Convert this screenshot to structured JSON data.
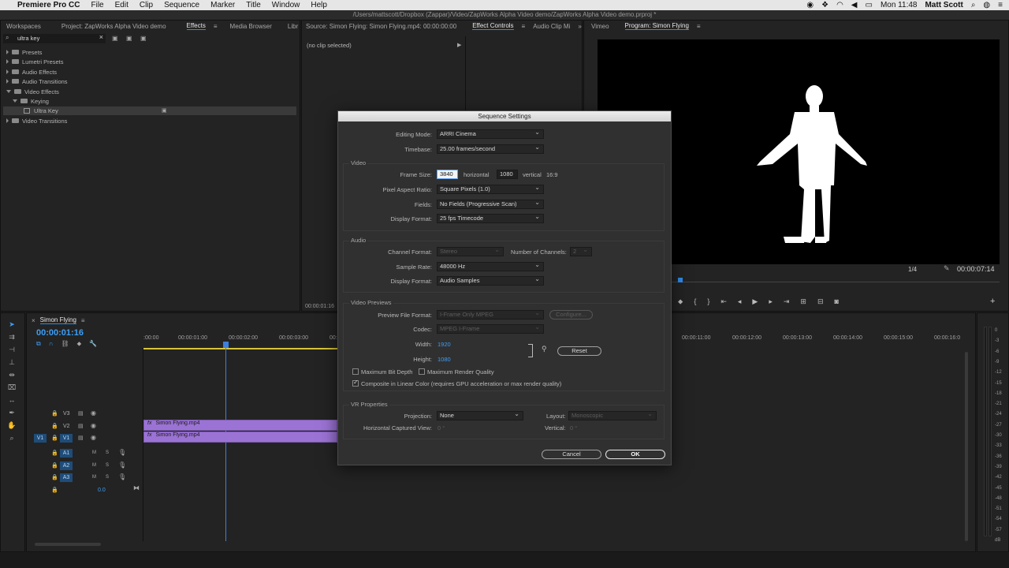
{
  "menubar": {
    "apple": "",
    "app_name": "Premiere Pro CC",
    "menus": [
      "File",
      "Edit",
      "Clip",
      "Sequence",
      "Marker",
      "Title",
      "Window",
      "Help"
    ],
    "clock": "Mon 11:48",
    "user": "Matt Scott"
  },
  "window_title": "/Users/mattscott/Dropbox (Zappar)/Video/ZapWorks Alpha Video demo/ZapWorks Alpha Video demo.prproj *",
  "left_panel": {
    "tabs": [
      "Workspaces",
      "Project: ZapWorks Alpha Video demo",
      "Effects",
      "Media Browser",
      "Libr"
    ],
    "search_value": "ultra key",
    "tree": [
      "Presets",
      "Lumetri Presets",
      "Audio Effects",
      "Audio Transitions",
      "Video Effects",
      "Keying",
      "Ultra Key",
      "Video Transitions"
    ]
  },
  "source_panel": {
    "tabs": [
      "Source: Simon Flying: Simon Flying.mp4: 00:00:00:00",
      "Effect Controls",
      "Audio Clip Mi"
    ],
    "no_clip": "(no clip selected)",
    "timecode": "00:00:01:16"
  },
  "program_panel": {
    "tabs": [
      "Vimeo",
      "Program: Simon Flying"
    ],
    "zoom": "1/4",
    "timecode": "00:00:07:14"
  },
  "timeline": {
    "tab": "Simon Flying",
    "timecode": "00:00:01:16",
    "ruler": [
      ":00:00",
      "00:00:01:00",
      "00:00:02:00",
      "00:00:03:00",
      "00:",
      "00:00:11:00",
      "00:00:12:00",
      "00:00:13:00",
      "00:00:14:00",
      "00:00:15:00",
      "00:00:16:0"
    ],
    "video_tracks": [
      "V3",
      "V2",
      "V1"
    ],
    "audio_tracks": [
      "A1",
      "A2",
      "A3"
    ],
    "source_patch": "V1",
    "mute": "M",
    "solo": "S",
    "master_level": "0.0",
    "clips": [
      "Simon Flying.mp4",
      "Simon Flying.mp4"
    ],
    "meter_db": [
      "0",
      "-3",
      "-6",
      "-9",
      "-12",
      "-15",
      "-18",
      "-21",
      "-24",
      "-27",
      "-30",
      "-33",
      "-36",
      "-39",
      "-42",
      "-45",
      "-48",
      "-51",
      "-54",
      "-57",
      "dB"
    ]
  },
  "dialog": {
    "title": "Sequence Settings",
    "editing_mode_label": "Editing Mode:",
    "editing_mode": "ARRI Cinema",
    "timebase_label": "Timebase:",
    "timebase": "25.00  frames/second",
    "video_section": "Video",
    "frame_size_label": "Frame Size:",
    "frame_width": "3840",
    "horizontal": "horizontal",
    "frame_height": "1080",
    "vertical": "vertical",
    "aspect": "16:9",
    "pixel_aspect_label": "Pixel Aspect Ratio:",
    "pixel_aspect": "Square Pixels (1.0)",
    "fields_label": "Fields:",
    "fields": "No Fields (Progressive Scan)",
    "display_format_label": "Display Format:",
    "display_format": "25 fps Timecode",
    "audio_section": "Audio",
    "channel_format_label": "Channel Format:",
    "channel_format": "Stereo",
    "num_channels_label": "Number of Channels:",
    "num_channels": "2",
    "sample_rate_label": "Sample Rate:",
    "sample_rate": "48000 Hz",
    "audio_display_format_label": "Display Format:",
    "audio_display_format": "Audio Samples",
    "previews_section": "Video Previews",
    "preview_format_label": "Preview File Format:",
    "preview_format": "I-Frame Only MPEG",
    "configure": "Configure...",
    "codec_label": "Codec:",
    "codec": "MPEG I-Frame",
    "width_label": "Width:",
    "width": "1920",
    "height_label": "Height:",
    "height": "1080",
    "reset": "Reset",
    "max_bit_depth": "Maximum Bit Depth",
    "max_render_quality": "Maximum Render Quality",
    "linear_color": "Composite in Linear Color (requires GPU acceleration or max render quality)",
    "vr_section": "VR Properties",
    "projection_label": "Projection:",
    "projection": "None",
    "layout_label": "Layout:",
    "layout": "Monoscopic",
    "h_view_label": "Horizontal Captured View:",
    "h_view": "0 °",
    "v_label": "Vertical:",
    "v_view": "0 °",
    "cancel": "Cancel",
    "ok": "OK"
  },
  "colors": {
    "accent": "#2d8ceb",
    "clip": "#9b73d4",
    "playhead": "#3d7fdc"
  }
}
